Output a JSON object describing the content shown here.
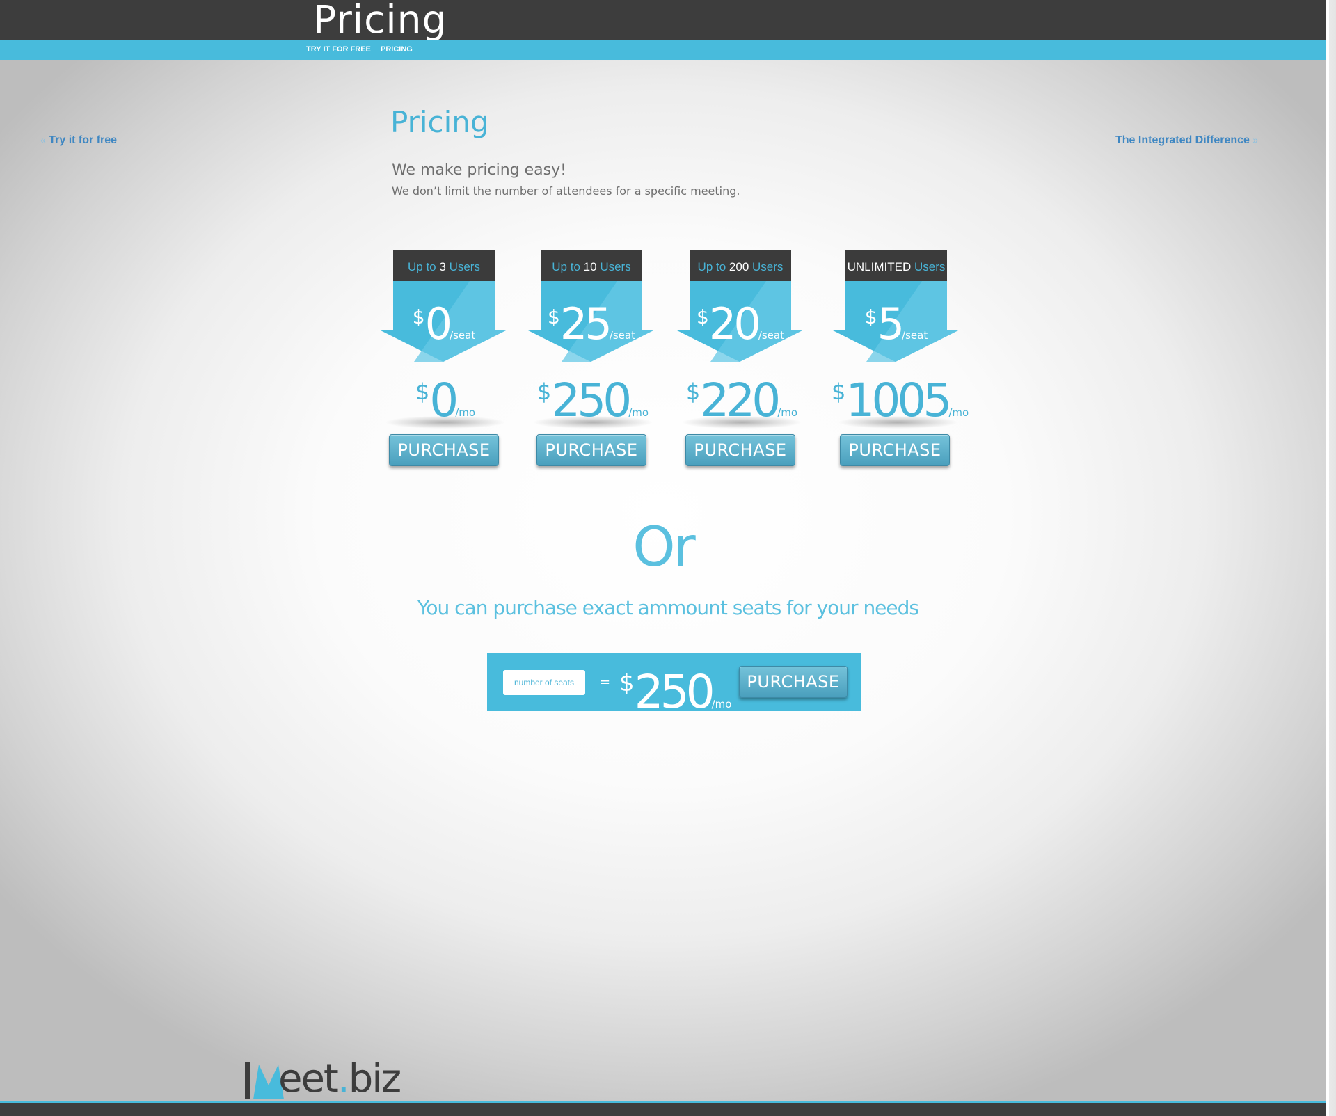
{
  "header": {
    "title": "Pricing",
    "nav": [
      {
        "label": "TRY IT FOR FREE"
      },
      {
        "label": "PRICING"
      }
    ]
  },
  "side_nav": {
    "prev": {
      "arrow": "«",
      "label": "Try it for free"
    },
    "next": {
      "label": "The Integrated Difference",
      "arrow": "»"
    }
  },
  "main": {
    "heading": "Pricing",
    "lead": "We make pricing easy!",
    "sub_lead": "We don’t limit the number of attendees for a specific meeting."
  },
  "plans": [
    {
      "tab_prefix": "Up to",
      "tab_count": "3",
      "tab_suffix": "Users",
      "seat_symbol": "$",
      "seat_price": "0",
      "seat_unit": "/seat",
      "mo_symbol": "$",
      "mo_price": "0",
      "mo_unit": "/mo",
      "button": "PURCHASE"
    },
    {
      "tab_prefix": "Up to",
      "tab_count": "10",
      "tab_suffix": "Users",
      "seat_symbol": "$",
      "seat_price": "25",
      "seat_unit": "/seat",
      "mo_symbol": "$",
      "mo_price": "250",
      "mo_unit": "/mo",
      "button": "PURCHASE"
    },
    {
      "tab_prefix": "Up to",
      "tab_count": "200",
      "tab_suffix": "Users",
      "seat_symbol": "$",
      "seat_price": "20",
      "seat_unit": "/seat",
      "mo_symbol": "$",
      "mo_price": "220",
      "mo_unit": "/mo",
      "button": "PURCHASE"
    },
    {
      "tab_prefix": "",
      "tab_count": "UNLIMITED",
      "tab_suffix": "Users",
      "seat_symbol": "$",
      "seat_price": "5",
      "seat_unit": "/seat",
      "mo_symbol": "$",
      "mo_price": "1005",
      "mo_unit": "/mo",
      "button": "PURCHASE"
    }
  ],
  "or_section": {
    "or": "Or",
    "subtitle": "You can purchase exact ammount seats for your needs"
  },
  "calculator": {
    "input_placeholder": "number of seats",
    "input_value": "",
    "equals": "=",
    "price_symbol": "$",
    "price": "250",
    "unit": "/mo",
    "button": "PURCHASE"
  },
  "footer": {
    "logo_i": "I",
    "logo_word": "eet",
    "logo_dot": ".",
    "logo_tld": "biz"
  },
  "colors": {
    "accent": "#48bbdc",
    "dark": "#3d3d3d",
    "link": "#3f87c2",
    "text_gray": "#6e6e6e"
  }
}
